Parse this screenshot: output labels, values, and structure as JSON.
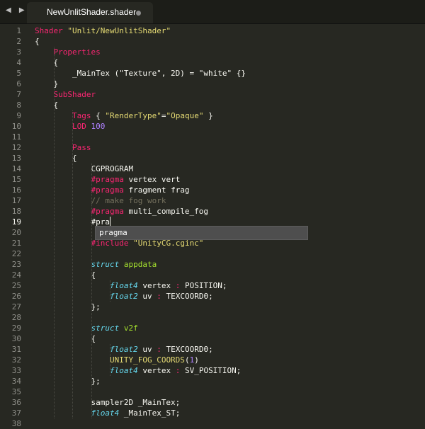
{
  "nav": {
    "back_icon": "triangle-left-icon",
    "forward_icon": "triangle-right-icon",
    "glyph": "◀ ▶"
  },
  "tab": {
    "title": "NewUnlitShader.shader",
    "unsaved_dot": "circle-icon"
  },
  "editor": {
    "current_line": 19,
    "colors": {
      "background": "#272822",
      "keyword": "#f92672",
      "string": "#e6db74",
      "number": "#ae81ff",
      "comment": "#75715e",
      "type": "#66d9ef",
      "entity": "#a6e22e",
      "text": "#f8f8f2"
    },
    "lines": [
      [
        {
          "t": "Shader",
          "c": "kw"
        },
        {
          "t": " "
        },
        {
          "t": "\"Unlit/NewUnlitShader\"",
          "c": "str"
        }
      ],
      [
        {
          "t": "{"
        }
      ],
      [
        {
          "t": "    "
        },
        {
          "t": "Properties",
          "c": "kw"
        }
      ],
      [
        {
          "t": "    {"
        }
      ],
      [
        {
          "t": "        _MainTex (\"Texture\", 2D) = \"white\" {}"
        }
      ],
      [
        {
          "t": "    }"
        }
      ],
      [
        {
          "t": "    "
        },
        {
          "t": "SubShader",
          "c": "kw"
        }
      ],
      [
        {
          "t": "    {"
        }
      ],
      [
        {
          "t": "        "
        },
        {
          "t": "Tags",
          "c": "kw"
        },
        {
          "t": " { "
        },
        {
          "t": "\"RenderType\"",
          "c": "str"
        },
        {
          "t": "="
        },
        {
          "t": "\"Opaque\"",
          "c": "str"
        },
        {
          "t": " }"
        }
      ],
      [
        {
          "t": "        "
        },
        {
          "t": "LOD",
          "c": "kw"
        },
        {
          "t": " "
        },
        {
          "t": "100",
          "c": "num"
        }
      ],
      [],
      [
        {
          "t": "        "
        },
        {
          "t": "Pass",
          "c": "kw"
        }
      ],
      [
        {
          "t": "        {"
        }
      ],
      [
        {
          "t": "            CGPROGRAM"
        }
      ],
      [
        {
          "t": "            "
        },
        {
          "t": "#pragma",
          "c": "kw"
        },
        {
          "t": " vertex vert"
        }
      ],
      [
        {
          "t": "            "
        },
        {
          "t": "#pragma",
          "c": "kw"
        },
        {
          "t": " fragment frag"
        }
      ],
      [
        {
          "t": "            "
        },
        {
          "t": "// make fog work",
          "c": "cm"
        }
      ],
      [
        {
          "t": "            "
        },
        {
          "t": "#pragma",
          "c": "kw"
        },
        {
          "t": " multi_compile_fog"
        }
      ],
      [
        {
          "t": "            #pra"
        }
      ],
      [],
      [
        {
          "t": "            "
        },
        {
          "t": "#include",
          "c": "kw"
        },
        {
          "t": " "
        },
        {
          "t": "\"UnityCG.cginc\"",
          "c": "str"
        }
      ],
      [],
      [
        {
          "t": "            "
        },
        {
          "t": "struct",
          "c": "ty"
        },
        {
          "t": " "
        },
        {
          "t": "appdata",
          "c": "ent"
        }
      ],
      [
        {
          "t": "            {"
        }
      ],
      [
        {
          "t": "                "
        },
        {
          "t": "float4",
          "c": "ty"
        },
        {
          "t": " vertex "
        },
        {
          "t": ":",
          "c": "kw"
        },
        {
          "t": " POSITION;"
        }
      ],
      [
        {
          "t": "                "
        },
        {
          "t": "float2",
          "c": "ty"
        },
        {
          "t": " uv "
        },
        {
          "t": ":",
          "c": "kw"
        },
        {
          "t": " TEXCOORD0;"
        }
      ],
      [
        {
          "t": "            };"
        }
      ],
      [],
      [
        {
          "t": "            "
        },
        {
          "t": "struct",
          "c": "ty"
        },
        {
          "t": " "
        },
        {
          "t": "v2f",
          "c": "ent"
        }
      ],
      [
        {
          "t": "            {"
        }
      ],
      [
        {
          "t": "                "
        },
        {
          "t": "float2",
          "c": "ty"
        },
        {
          "t": " uv "
        },
        {
          "t": ":",
          "c": "kw"
        },
        {
          "t": " TEXCOORD0;"
        }
      ],
      [
        {
          "t": "                "
        },
        {
          "t": "UNITY_FOG_COORDS",
          "c": "str"
        },
        {
          "t": "("
        },
        {
          "t": "1",
          "c": "num"
        },
        {
          "t": ")"
        }
      ],
      [
        {
          "t": "                "
        },
        {
          "t": "float4",
          "c": "ty"
        },
        {
          "t": " vertex "
        },
        {
          "t": ":",
          "c": "kw"
        },
        {
          "t": " SV_POSITION;"
        }
      ],
      [
        {
          "t": "            };"
        }
      ],
      [],
      [
        {
          "t": "            sampler2D _MainTex;"
        }
      ],
      [
        {
          "t": "            "
        },
        {
          "t": "float4",
          "c": "ty"
        },
        {
          "t": " _MainTex_ST;"
        }
      ],
      []
    ]
  },
  "autocomplete": {
    "items": [
      "pragma"
    ]
  }
}
